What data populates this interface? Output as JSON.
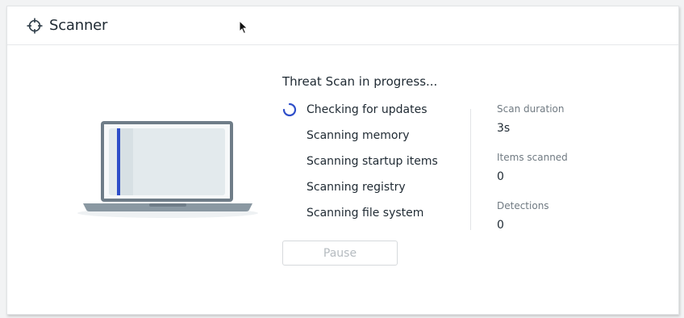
{
  "header": {
    "title": "Scanner",
    "icon": "crosshair-icon"
  },
  "scan": {
    "title": "Threat Scan in progress...",
    "steps": [
      {
        "label": "Checking for updates",
        "state": "in-progress"
      },
      {
        "label": "Scanning memory",
        "state": "pending"
      },
      {
        "label": "Scanning startup items",
        "state": "pending"
      },
      {
        "label": "Scanning registry",
        "state": "pending"
      },
      {
        "label": "Scanning file system",
        "state": "pending"
      }
    ],
    "pause_label": "Pause"
  },
  "stats": [
    {
      "label": "Scan duration",
      "value": "3s"
    },
    {
      "label": "Items scanned",
      "value": "0"
    },
    {
      "label": "Detections",
      "value": "0"
    }
  ],
  "colors": {
    "accent": "#2f4fc9",
    "text": "#1f2a33",
    "muted": "#707a82",
    "disabled": "#b5bbc0"
  }
}
